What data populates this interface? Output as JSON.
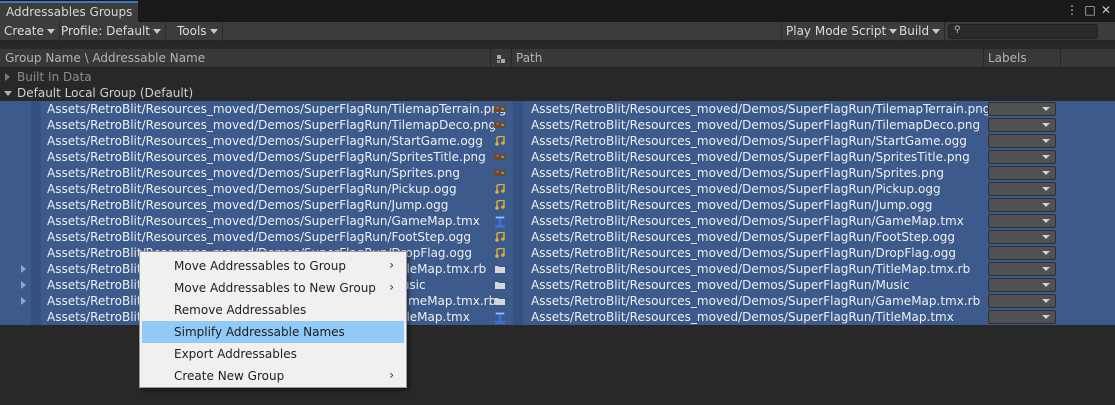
{
  "window": {
    "tab_title": "Addressables Groups",
    "menu_icon": "⋮",
    "maximize_icon": "□",
    "close_icon": "✕"
  },
  "toolbar": {
    "create": "Create",
    "profile": "Profile: Default",
    "tools": "Tools",
    "play_mode": "Play Mode Script",
    "build": "Build",
    "search_value": ""
  },
  "columns": {
    "name": "Group Name \\ Addressable Name",
    "path": "Path",
    "labels": "Labels"
  },
  "groups": [
    {
      "label": "Built In Data",
      "expanded": false
    },
    {
      "label": "Default Local Group (Default)",
      "expanded": true
    }
  ],
  "entries": [
    {
      "name": "Assets/RetroBlit/Resources_moved/Demos/SuperFlagRun/TilemapTerrain.png",
      "path": "Assets/RetroBlit/Resources_moved/Demos/SuperFlagRun/TilemapTerrain.png",
      "icon": "texture-icon",
      "expandable": false
    },
    {
      "name": "Assets/RetroBlit/Resources_moved/Demos/SuperFlagRun/TilemapDeco.png",
      "path": "Assets/RetroBlit/Resources_moved/Demos/SuperFlagRun/TilemapDeco.png",
      "icon": "texture-icon",
      "expandable": false
    },
    {
      "name": "Assets/RetroBlit/Resources_moved/Demos/SuperFlagRun/StartGame.ogg",
      "path": "Assets/RetroBlit/Resources_moved/Demos/SuperFlagRun/StartGame.ogg",
      "icon": "audio-icon",
      "expandable": false
    },
    {
      "name": "Assets/RetroBlit/Resources_moved/Demos/SuperFlagRun/SpritesTitle.png",
      "path": "Assets/RetroBlit/Resources_moved/Demos/SuperFlagRun/SpritesTitle.png",
      "icon": "texture-icon",
      "expandable": false
    },
    {
      "name": "Assets/RetroBlit/Resources_moved/Demos/SuperFlagRun/Sprites.png",
      "path": "Assets/RetroBlit/Resources_moved/Demos/SuperFlagRun/Sprites.png",
      "icon": "texture-icon",
      "expandable": false
    },
    {
      "name": "Assets/RetroBlit/Resources_moved/Demos/SuperFlagRun/Pickup.ogg",
      "path": "Assets/RetroBlit/Resources_moved/Demos/SuperFlagRun/Pickup.ogg",
      "icon": "audio-icon",
      "expandable": false
    },
    {
      "name": "Assets/RetroBlit/Resources_moved/Demos/SuperFlagRun/Jump.ogg",
      "path": "Assets/RetroBlit/Resources_moved/Demos/SuperFlagRun/Jump.ogg",
      "icon": "audio-icon",
      "expandable": false
    },
    {
      "name": "Assets/RetroBlit/Resources_moved/Demos/SuperFlagRun/GameMap.tmx",
      "path": "Assets/RetroBlit/Resources_moved/Demos/SuperFlagRun/GameMap.tmx",
      "icon": "tmx-icon",
      "expandable": false
    },
    {
      "name": "Assets/RetroBlit/Resources_moved/Demos/SuperFlagRun/FootStep.ogg",
      "path": "Assets/RetroBlit/Resources_moved/Demos/SuperFlagRun/FootStep.ogg",
      "icon": "audio-icon",
      "expandable": false
    },
    {
      "name": "Assets/RetroBlit/Resources_moved/Demos/SuperFlagRun/DropFlag.ogg",
      "path": "Assets/RetroBlit/Resources_moved/Demos/SuperFlagRun/DropFlag.ogg",
      "icon": "audio-icon",
      "expandable": false
    },
    {
      "name": "Assets/RetroBlit/Resources_moved/Demos/SuperFlagRun/TitleMap.tmx.rb",
      "path": "Assets/RetroBlit/Resources_moved/Demos/SuperFlagRun/TitleMap.tmx.rb",
      "icon": "folder-icon",
      "expandable": true
    },
    {
      "name": "Assets/RetroBlit/Resources_moved/Demos/SuperFlagRun/Music",
      "path": "Assets/RetroBlit/Resources_moved/Demos/SuperFlagRun/Music",
      "icon": "folder-icon",
      "expandable": true
    },
    {
      "name": "Assets/RetroBlit/Resources_moved/Demos/SuperFlagRun/GameMap.tmx.rb",
      "path": "Assets/RetroBlit/Resources_moved/Demos/SuperFlagRun/GameMap.tmx.rb",
      "icon": "folder-icon",
      "expandable": true
    },
    {
      "name": "Assets/RetroBlit/Resources_moved/Demos/SuperFlagRun/TitleMap.tmx",
      "path": "Assets/RetroBlit/Resources_moved/Demos/SuperFlagRun/TitleMap.tmx",
      "icon": "tmx-icon",
      "expandable": false
    }
  ],
  "context_menu": {
    "items": [
      {
        "label": "Move Addressables to Group",
        "submenu": true,
        "highlighted": false
      },
      {
        "label": "Move Addressables to New Group",
        "submenu": true,
        "highlighted": false
      },
      {
        "label": "Remove Addressables",
        "submenu": false,
        "highlighted": false
      },
      {
        "label": "Simplify Addressable Names",
        "submenu": false,
        "highlighted": true
      },
      {
        "label": "Export Addressables",
        "submenu": false,
        "highlighted": false
      },
      {
        "label": "Create New Group",
        "submenu": true,
        "highlighted": false
      }
    ]
  },
  "colors": {
    "selection": "#3c5a8c",
    "menu_highlight": "#91c9f7",
    "tab_accent": "#3a79bb"
  }
}
